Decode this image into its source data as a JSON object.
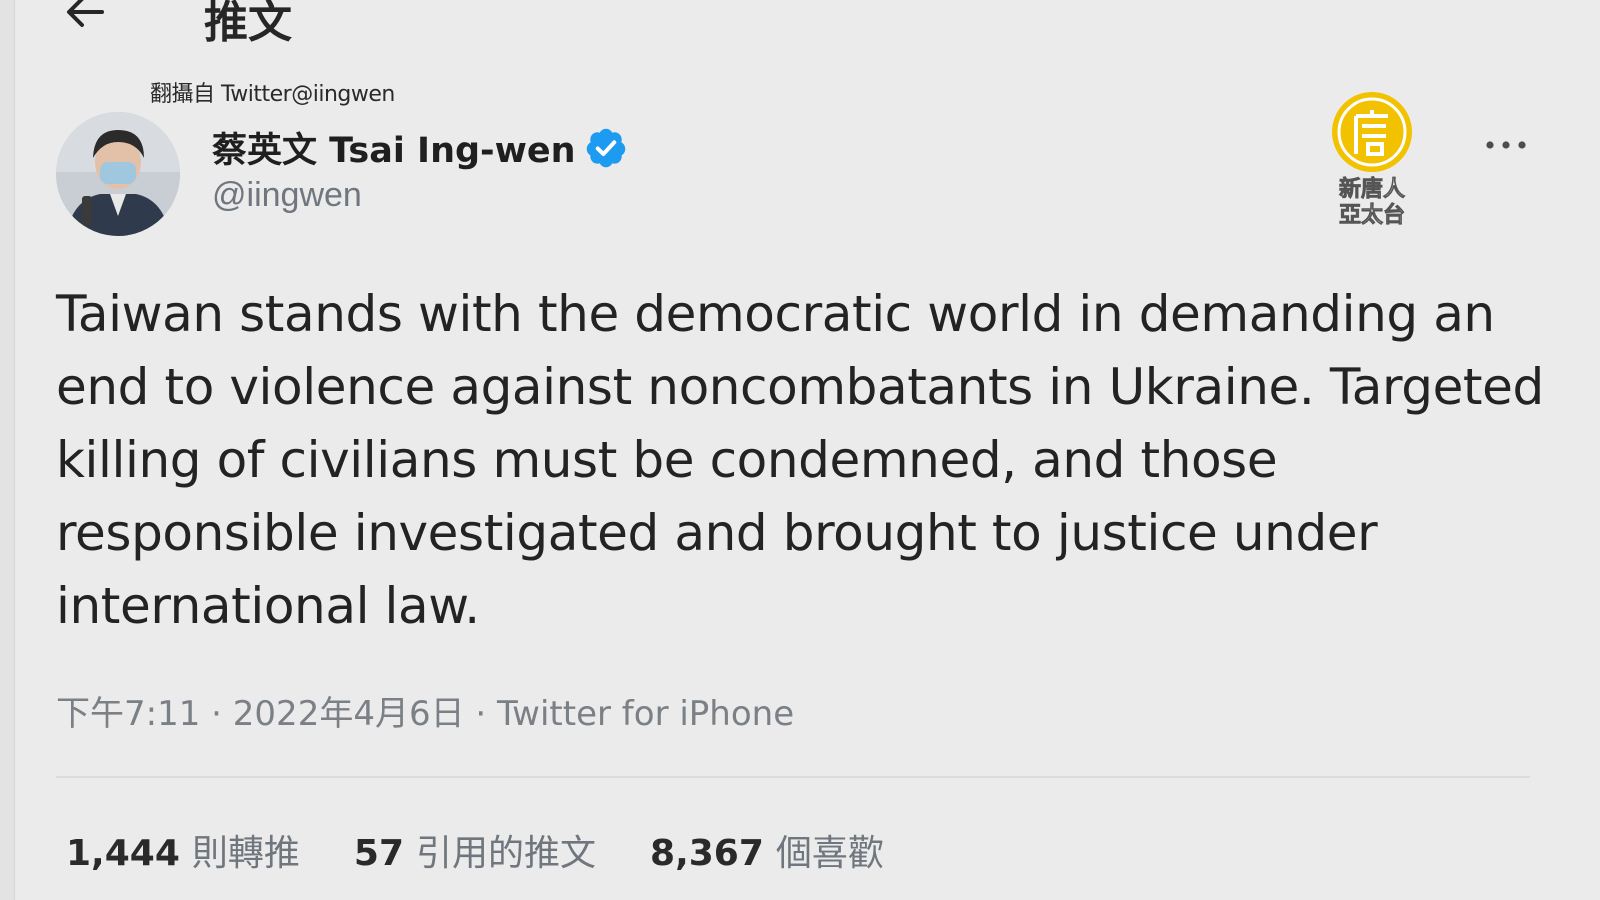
{
  "header": {
    "title": "推文"
  },
  "source_credit": "翻攝自 Twitter@iingwen",
  "author": {
    "display_name": "蔡英文 Tsai Ing-wen",
    "handle": "@iingwen",
    "verified": true
  },
  "tweet": {
    "text": "Taiwan stands with the democratic world in demanding an end to violence against noncombatants in Ukraine. Targeted killing of civilians must be condemned, and those responsible investigated and brought to justice under international law.",
    "time": "下午7:11",
    "date": "2022年4月6日",
    "client": "Twitter for iPhone",
    "separator": " · "
  },
  "stats": {
    "retweets": {
      "count": "1,444",
      "label": "則轉推"
    },
    "quotes": {
      "count": "57",
      "label": "引用的推文"
    },
    "likes": {
      "count": "8,367",
      "label": "個喜歡"
    }
  },
  "watermark": {
    "logo_text": "新唐人亞太台",
    "color": "#f2c200"
  },
  "colors": {
    "verified": "#1d9bf0",
    "secondary_text": "#6f767d",
    "background": "#ebebeb"
  },
  "icons": [
    "back-arrow-icon",
    "verified-badge-icon",
    "more-options-icon"
  ]
}
